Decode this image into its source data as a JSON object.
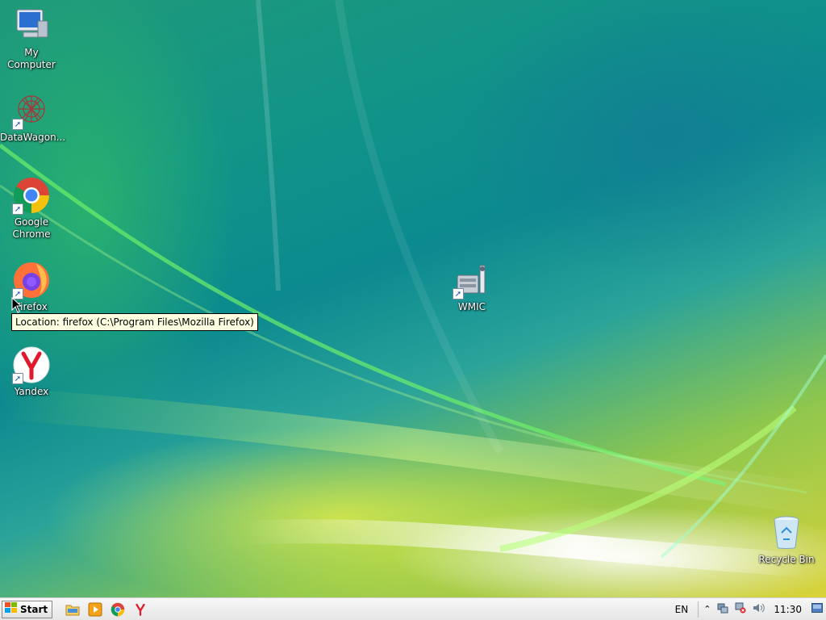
{
  "desktop": {
    "icons": [
      {
        "label": "My Computer",
        "icon": "computer-icon"
      },
      {
        "label": "DataWagon...",
        "icon": "datawagon-icon"
      },
      {
        "label": "Google Chrome",
        "icon": "chrome-icon"
      },
      {
        "label": "Firefox",
        "icon": "firefox-icon"
      },
      {
        "label": "Yandex",
        "icon": "yandex-icon"
      },
      {
        "label": "WMIC",
        "icon": "wmic-icon"
      },
      {
        "label": "Recycle Bin",
        "icon": "recycle-bin-icon"
      }
    ],
    "tooltip": "Location: firefox (C:\\Program Files\\Mozilla Firefox)"
  },
  "taskbar": {
    "start_label": "Start",
    "quick_launch": [
      "folder-icon",
      "media-player-icon",
      "chrome-icon",
      "yandex-icon"
    ],
    "language": "EN",
    "clock": "11:30"
  },
  "colors": {
    "tooltip_bg": "#ffffe1",
    "taskbar_bg": "#ececec"
  }
}
